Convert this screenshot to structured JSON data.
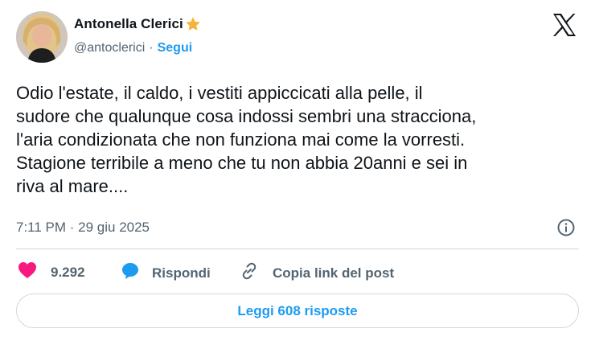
{
  "author": {
    "display_name": "Antonella Clerici",
    "badge_icon": "star-icon",
    "badge_color": "#f4b43a",
    "handle": "@antoclerici",
    "separator": "·",
    "follow_label": "Segui",
    "avatar_icon": "avatar"
  },
  "brand": {
    "logo_icon": "x-logo-icon"
  },
  "tweet": {
    "text": "Odio l'estate, il caldo, i vestiti appiccicati alla pelle, il\nsudore che qualunque cosa indossi sembri una stracciona,\nl'aria condizionata che non funziona mai come la vorresti.\nStagione terribile a meno che tu non abbia 20anni e sei in\nriva al mare....",
    "timestamp": "7:11 PM · 29 giu 2025"
  },
  "actions": {
    "like_count": "9.292",
    "like_icon": "heart-icon",
    "reply_label": "Rispondi",
    "reply_icon": "speech-bubble-icon",
    "copy_label": "Copia link del post",
    "copy_icon": "link-icon"
  },
  "footer": {
    "read_replies_label": "Leggi 608 risposte"
  },
  "colors": {
    "accent": "#1d9bf0",
    "like": "#f91880",
    "reply": "#1d9bf0",
    "secondary_text": "#536471",
    "border": "#cfd9de"
  }
}
